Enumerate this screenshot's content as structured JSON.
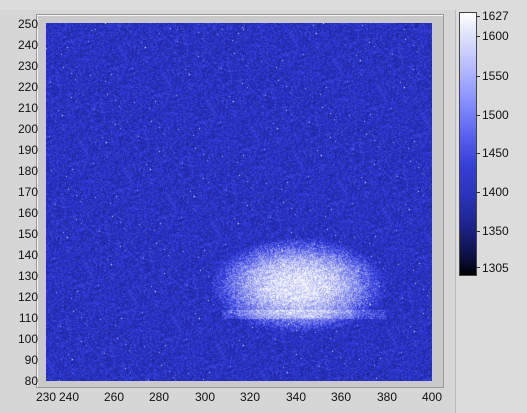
{
  "graph": {
    "y_axis": {
      "min": 80,
      "max": 250,
      "ticks": [
        "250",
        "240",
        "230",
        "220",
        "210",
        "200",
        "190",
        "180",
        "170",
        "160",
        "150",
        "140",
        "130",
        "120",
        "110",
        "100",
        "90",
        "80"
      ]
    },
    "x_axis": {
      "min": 230,
      "max": 400,
      "ticks": [
        "230",
        "240",
        "260",
        "280",
        "300",
        "320",
        "340",
        "360",
        "380",
        "400"
      ]
    },
    "image_colors": {
      "background": "#2c36c9",
      "hot": "#d6dbff"
    }
  },
  "colorbar": {
    "labels": [
      "1627",
      "1600",
      "1550",
      "1500",
      "1450",
      "1400",
      "1350",
      "1305"
    ],
    "max": 1627,
    "min": 1305
  }
}
